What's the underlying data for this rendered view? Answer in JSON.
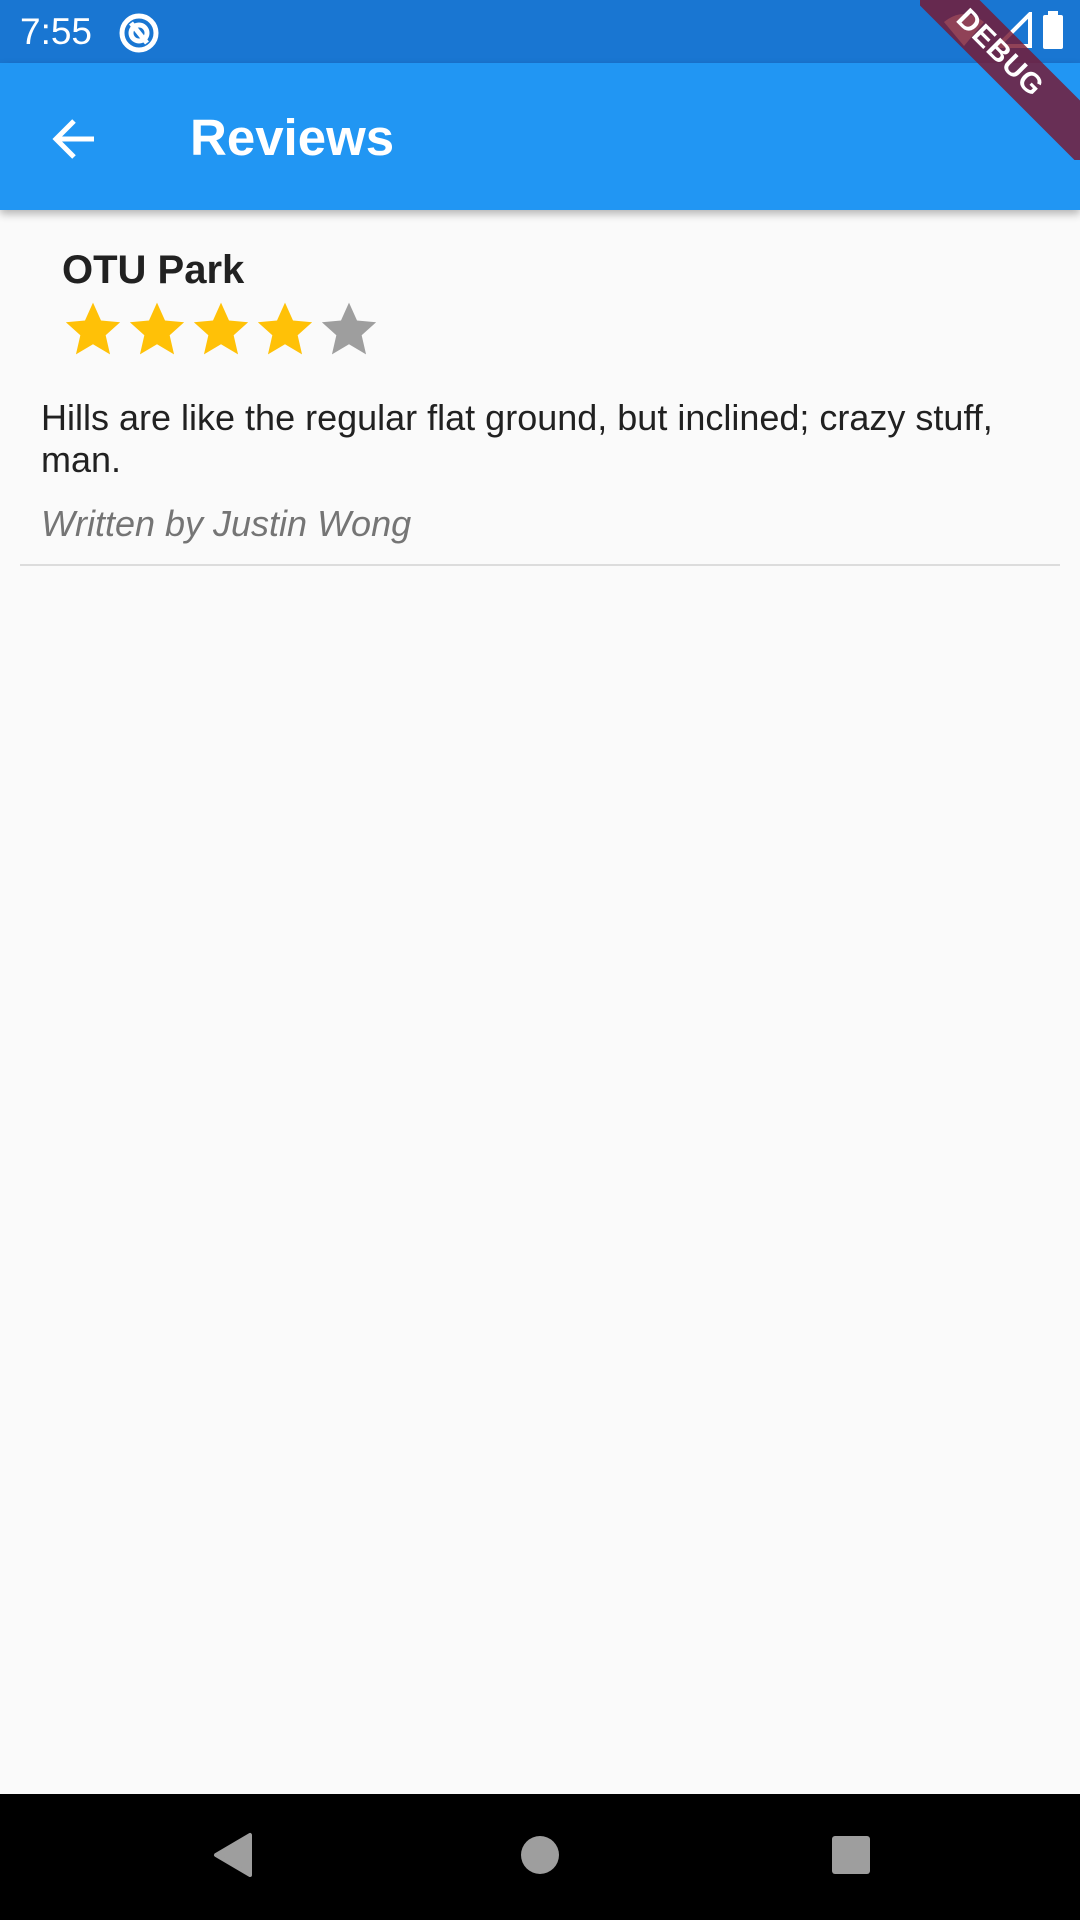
{
  "status_bar": {
    "time": "7:55",
    "icons": [
      "app-notification-icon",
      "wifi-icon",
      "signal-icon",
      "battery-icon"
    ]
  },
  "app_bar": {
    "title": "Reviews",
    "back_icon": "arrow-back-icon",
    "color": "#2196f3"
  },
  "debug_banner": "DEBUG",
  "review": {
    "place": "OTU Park",
    "rating": 4,
    "max_rating": 5,
    "text": "Hills are like the regular flat ground, but inclined; crazy stuff, man.",
    "author": "Written by Justin Wong"
  },
  "colors": {
    "star_filled": "#ffc107",
    "star_empty": "#9e9e9e",
    "status_bar": "#1976d2"
  },
  "nav_bar": {
    "buttons": [
      "back-triangle-icon",
      "home-circle-icon",
      "recents-square-icon"
    ]
  }
}
